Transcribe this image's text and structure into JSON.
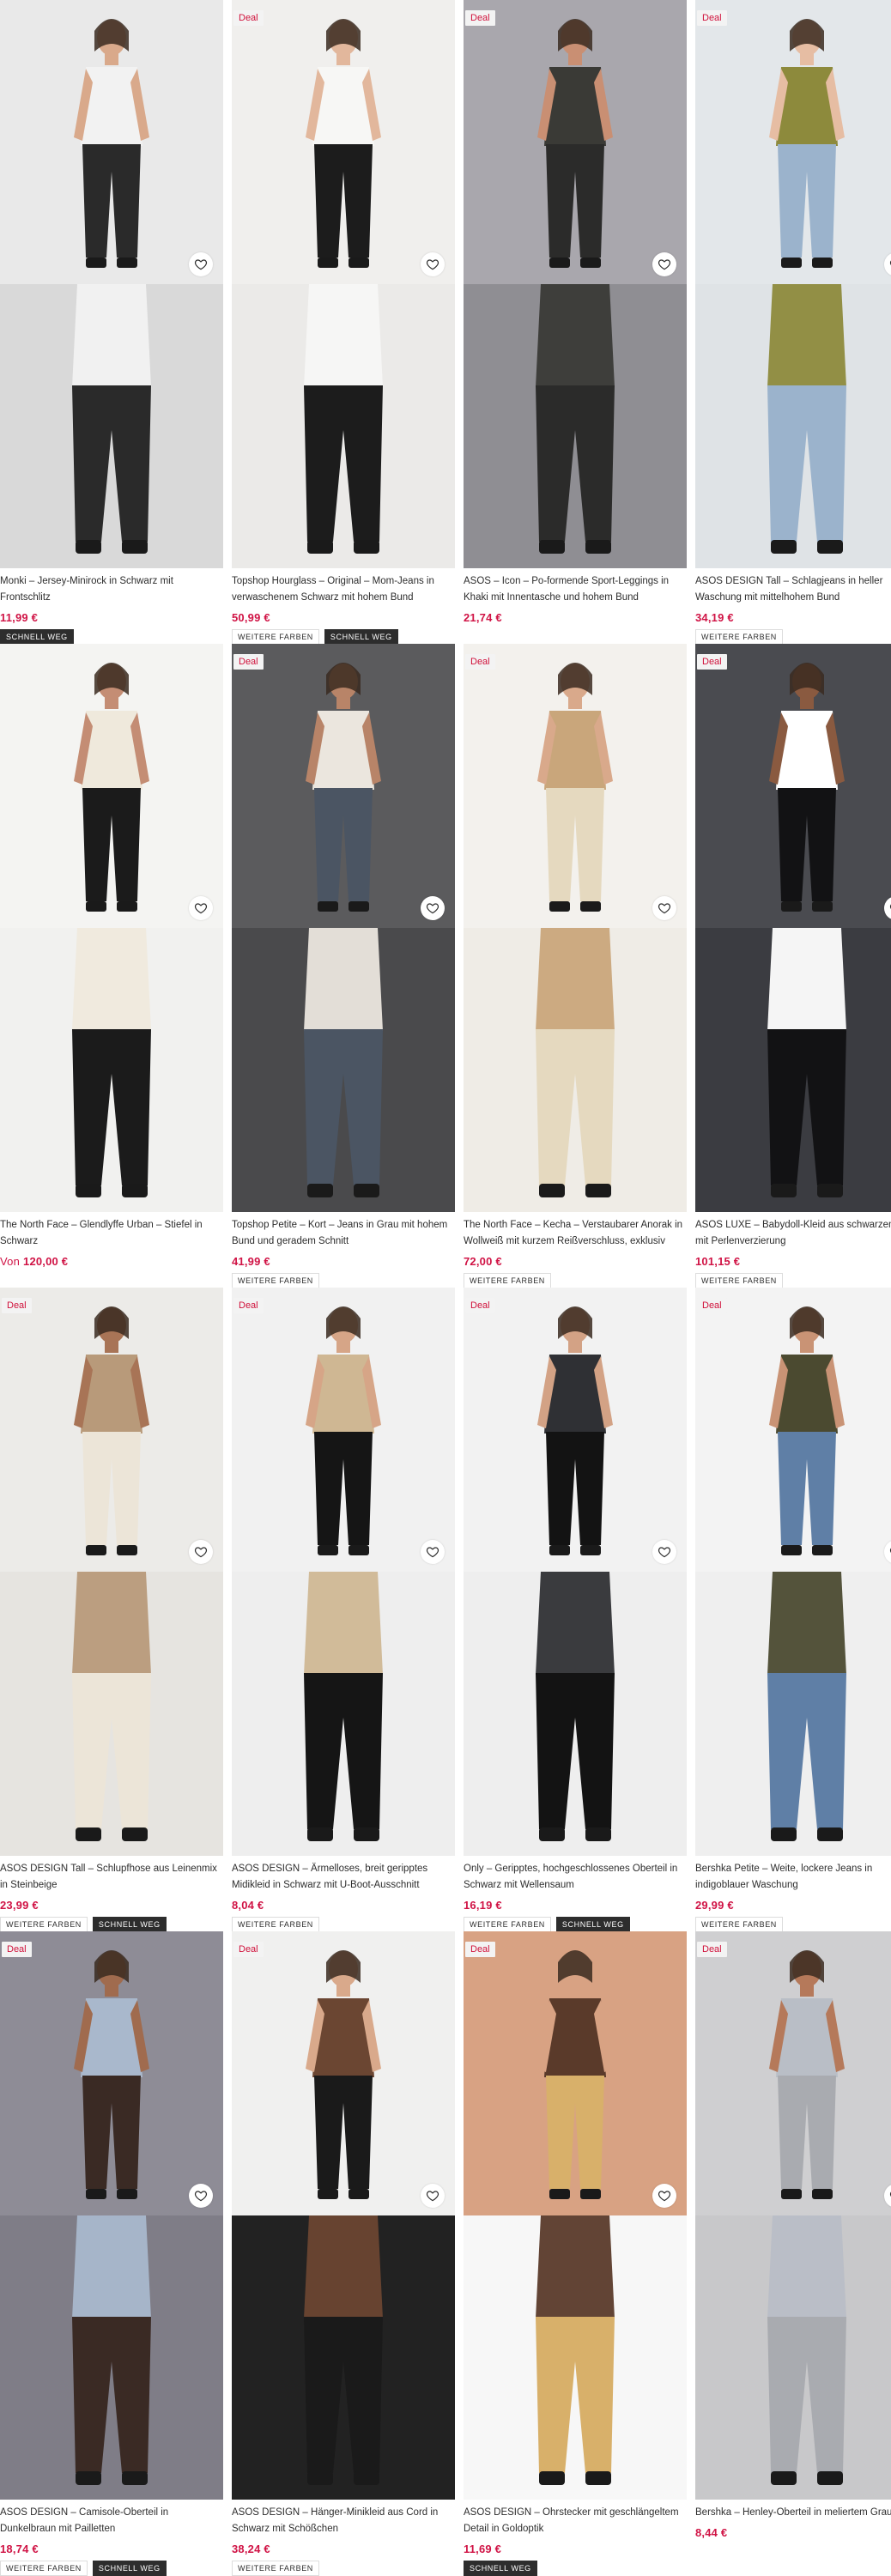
{
  "products": [
    {
      "title": "Monki – Jersey-Minirock in Schwarz mit Frontschlitz",
      "price": "11,99 €",
      "price_prefix": "",
      "deal": "",
      "badges": [
        "SCHNELL WEG"
      ],
      "palette": {
        "bg": "#e9e9e9",
        "bg2": "#d9d9d9",
        "a": "#2a2a2a",
        "b": "#f2f2f2",
        "skin": "#d9a98b"
      }
    },
    {
      "title": "Topshop Hourglass – Original – Mom-Jeans in verwaschenem Schwarz mit hohem Bund",
      "price": "50,99 €",
      "price_prefix": "",
      "deal": "Deal",
      "badges": [
        "WEITERE FARBEN",
        "SCHNELL WEG"
      ],
      "palette": {
        "bg": "#f0efed",
        "bg2": "#ebeae8",
        "a": "#1c1c1c",
        "b": "#f7f7f5",
        "skin": "#e2b79c"
      }
    },
    {
      "title": "ASOS – Icon – Po-formende Sport-Leggings in Khaki mit Innentasche und hohem Bund",
      "price": "21,74 €",
      "price_prefix": "",
      "deal": "Deal",
      "badges": [],
      "palette": {
        "bg": "#a9a7ad",
        "bg2": "#8f8e93",
        "a": "#2b2b2a",
        "b": "#3a3a36",
        "skin": "#c98f73"
      }
    },
    {
      "title": "ASOS DESIGN Tall – Schlagjeans in heller Waschung mit mittelhohem Bund",
      "price": "34,19 €",
      "price_prefix": "",
      "deal": "Deal",
      "badges": [
        "WEITERE FARBEN"
      ],
      "palette": {
        "bg": "#e3e7ea",
        "bg2": "#dfe3e6",
        "a": "#9bb3cc",
        "b": "#8d8a3c",
        "skin": "#e6bda3"
      }
    },
    {
      "title": "The North Face – Glendlyffe Urban – Stiefel in Schwarz",
      "price": "120,00 €",
      "price_prefix": "Von",
      "deal": "",
      "badges": [],
      "palette": {
        "bg": "#f4f4f2",
        "bg2": "#f1f1ef",
        "a": "#1b1b1b",
        "b": "#efe9dc",
        "skin": "#c48d74"
      }
    },
    {
      "title": "Topshop Petite – Kort – Jeans in Grau mit hohem Bund und geradem Schnitt",
      "price": "41,99 €",
      "price_prefix": "",
      "deal": "Deal",
      "badges": [
        "WEITERE FARBEN"
      ],
      "palette": {
        "bg": "#5b5b5d",
        "bg2": "#4a4a4c",
        "a": "#4b5563",
        "b": "#ebe6de",
        "skin": "#b88468"
      }
    },
    {
      "title": "The North Face – Kecha – Verstaubarer Anorak in Wollweiß mit kurzem Reißverschluss, exklusiv bei...",
      "price": "72,00 €",
      "price_prefix": "",
      "deal": "Deal",
      "badges": [
        "WEITERE FARBEN"
      ],
      "palette": {
        "bg": "#f3f1ed",
        "bg2": "#efece6",
        "a": "#e5d9bf",
        "b": "#c9a67b",
        "skin": "#d9a98b"
      }
    },
    {
      "title": "ASOS LUXE – Babydoll-Kleid aus schwarzem Tüll mit Perlenverzierung",
      "price": "101,15 €",
      "price_prefix": "",
      "deal": "Deal",
      "badges": [
        "WEITERE FARBEN"
      ],
      "palette": {
        "bg": "#4a4b50",
        "bg2": "#3b3c41",
        "a": "#121214",
        "b": "#ffffff",
        "skin": "#8a5a40"
      }
    },
    {
      "title": "ASOS DESIGN Tall – Schlupfhose aus Leinenmix in Steinbeige",
      "price": "23,99 €",
      "price_prefix": "",
      "deal": "Deal",
      "badges": [
        "WEITERE FARBEN",
        "SCHNELL WEG"
      ],
      "palette": {
        "bg": "#ecebe8",
        "bg2": "#e6e4e0",
        "a": "#ece5d8",
        "b": "#b89a7a",
        "skin": "#a87456"
      }
    },
    {
      "title": "ASOS DESIGN – Ärmelloses, breit geripptes Midikleid in Schwarz mit U-Boot-Ausschnitt",
      "price": "8,04 €",
      "price_prefix": "",
      "deal": "Deal",
      "badges": [
        "WEITERE FARBEN"
      ],
      "palette": {
        "bg": "#f1f1f1",
        "bg2": "#eeeeee",
        "a": "#151515",
        "b": "#cfb793",
        "skin": "#d6a587"
      }
    },
    {
      "title": "Only – Geripptes, hochgeschlossenes Oberteil in Schwarz mit Wellensaum",
      "price": "16,19 €",
      "price_prefix": "",
      "deal": "Deal",
      "badges": [
        "WEITERE FARBEN",
        "SCHNELL WEG"
      ],
      "palette": {
        "bg": "#f2f2f2",
        "bg2": "#eeeeee",
        "a": "#131313",
        "b": "#2f3034",
        "skin": "#d3a285"
      }
    },
    {
      "title": "Bershka Petite – Weite, lockere Jeans in indigoblauer Waschung",
      "price": "29,99 €",
      "price_prefix": "",
      "deal": "Deal",
      "badges": [
        "WEITERE FARBEN"
      ],
      "palette": {
        "bg": "#f3f3f3",
        "bg2": "#efefef",
        "a": "#5f7fa6",
        "b": "#4b4a30",
        "skin": "#c99375"
      }
    },
    {
      "title": "ASOS DESIGN – Camisole-Oberteil in Dunkelbraun mit Pailletten",
      "price": "18,74 €",
      "price_prefix": "",
      "deal": "Deal",
      "badges": [
        "WEITERE FARBEN",
        "SCHNELL WEG"
      ],
      "palette": {
        "bg": "#8e8c96",
        "bg2": "#7f7d87",
        "a": "#3a2a24",
        "b": "#a9b8cc",
        "skin": "#a06b4e"
      }
    },
    {
      "title": "ASOS DESIGN – Hänger-Minikleid aus Cord in Schwarz mit Schößchen",
      "price": "38,24 €",
      "price_prefix": "",
      "deal": "Deal",
      "badges": [
        "WEITERE FARBEN"
      ],
      "palette": {
        "bg": "#f0f0ef",
        "bg2": "#222222",
        "a": "#1a1a1a",
        "b": "#6b4632",
        "skin": "#d9a98b"
      }
    },
    {
      "title": "ASOS DESIGN – Ohrstecker mit geschlängeltem Detail in Goldoptik",
      "price": "11,69 €",
      "price_prefix": "",
      "deal": "Deal",
      "badges": [
        "SCHNELL WEG"
      ],
      "palette": {
        "bg": "#d8a283",
        "bg2": "#f7f7f7",
        "a": "#d8b06a",
        "b": "#5a3a2a",
        "skin": "#d8a283"
      }
    },
    {
      "title": "Bershka – Henley-Oberteil in meliertem Grau",
      "price": "8,44 €",
      "price_prefix": "",
      "deal": "Deal",
      "badges": [],
      "palette": {
        "bg": "#cfcfd1",
        "bg2": "#c8c8ca",
        "a": "#a9abb0",
        "b": "#b9bec6",
        "skin": "#b5795a"
      }
    }
  ]
}
